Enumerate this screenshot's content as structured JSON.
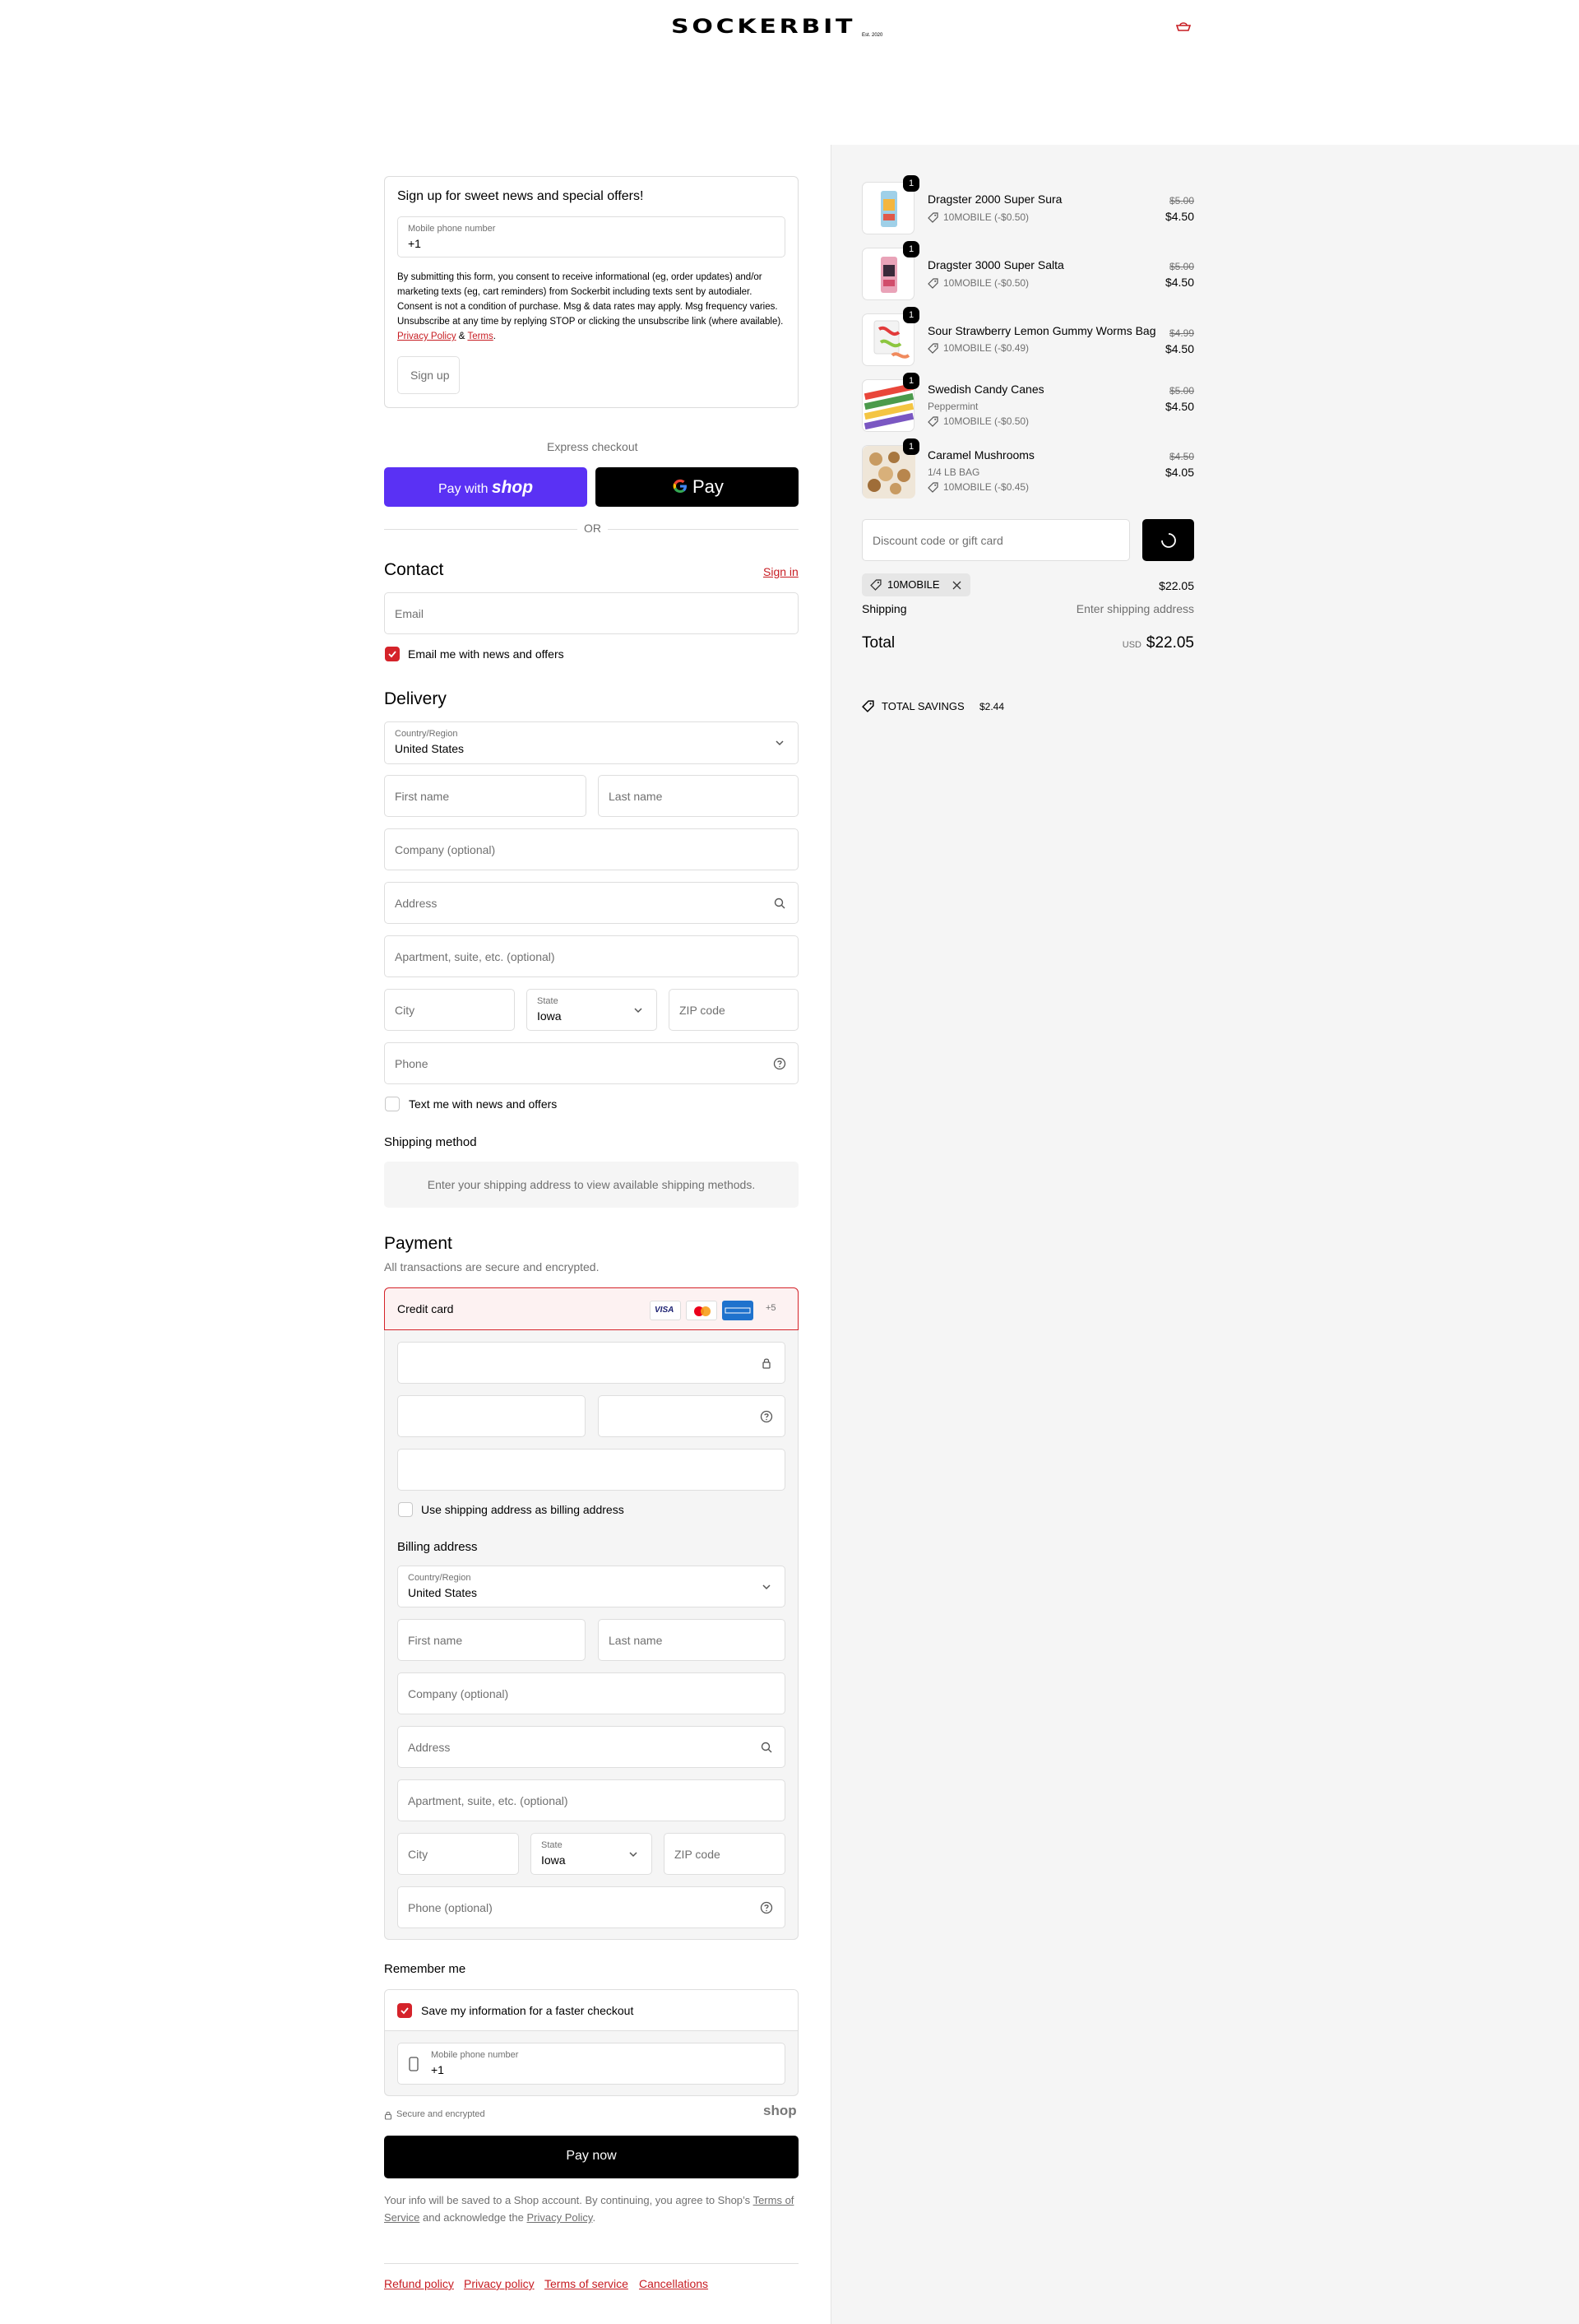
{
  "header": {
    "logo_text": "SOCKERBIT",
    "logo_sub": "Est. 2020"
  },
  "signup": {
    "title": "Sign up for sweet news and special offers!",
    "phone_label": "Mobile phone number",
    "phone_value": "+1",
    "consent": "By submitting this form, you consent to receive informational (eg, order updates) and/or marketing texts (eg, cart reminders) from Sockerbit including texts sent by autodialer. Consent is not a condition of purchase. Msg & data rates may apply. Msg frequency varies. Unsubscribe at any time by replying STOP or clicking the unsubscribe link (where available).",
    "privacy_link": "Privacy Policy",
    "amp": "&",
    "terms_link": "Terms",
    "button": "Sign up"
  },
  "express": {
    "title": "Express checkout",
    "shop_pay_prefix": "Pay with",
    "shop_pay_brand": "shop",
    "gpay_label": "Pay",
    "or": "OR"
  },
  "contact": {
    "title": "Contact",
    "sign_in": "Sign in",
    "email_placeholder": "Email",
    "news_label": "Email me with news and offers",
    "news_checked": true
  },
  "delivery": {
    "title": "Delivery",
    "country_label": "Country/Region",
    "country_value": "United States",
    "first_name": "First name",
    "last_name": "Last name",
    "company": "Company (optional)",
    "address": "Address",
    "apartment": "Apartment, suite, etc. (optional)",
    "city": "City",
    "state_label": "State",
    "state_value": "Iowa",
    "zip": "ZIP code",
    "phone": "Phone",
    "text_label": "Text me with news and offers",
    "text_checked": false
  },
  "shipping_method": {
    "title": "Shipping method",
    "notice": "Enter your shipping address to view available shipping methods."
  },
  "payment": {
    "title": "Payment",
    "subtitle": "All transactions are secure and encrypted.",
    "method_label": "Credit card",
    "cards": [
      "VISA",
      "mastercard",
      "AMEX"
    ],
    "more_cards": "+5",
    "billing_same_label": "Use shipping address as billing address",
    "billing_title": "Billing address",
    "billing": {
      "country_label": "Country/Region",
      "country_value": "United States",
      "first_name": "First name",
      "last_name": "Last name",
      "company": "Company (optional)",
      "address": "Address",
      "apartment": "Apartment, suite, etc. (optional)",
      "city": "City",
      "state_label": "State",
      "state_value": "Iowa",
      "zip": "ZIP code",
      "phone": "Phone (optional)"
    }
  },
  "remember": {
    "title": "Remember me",
    "save_label": "Save my information for a faster checkout",
    "save_checked": true,
    "phone_label": "Mobile phone number",
    "phone_value": "+1"
  },
  "secure": {
    "text": "Secure and encrypted",
    "brand": "shop"
  },
  "pay_now": "Pay now",
  "legal": {
    "line1": "Your info will be saved to a Shop account. By continuing, you agree to Shop’s",
    "tos": "Terms of Service",
    "mid": "and acknowledge the",
    "privacy": "Privacy Policy",
    "end": "."
  },
  "footer_links": [
    "Refund policy",
    "Privacy policy",
    "Terms of service",
    "Cancellations"
  ],
  "summary": {
    "items": [
      {
        "name": "Dragster 2000 Super Sura",
        "variant": "",
        "discount": "10MOBILE (-$0.50)",
        "old_price": "$5.00",
        "price": "$4.50",
        "qty": "1"
      },
      {
        "name": "Dragster 3000 Super Salta",
        "variant": "",
        "discount": "10MOBILE (-$0.50)",
        "old_price": "$5.00",
        "price": "$4.50",
        "qty": "1"
      },
      {
        "name": "Sour Strawberry Lemon Gummy Worms Bag",
        "variant": "",
        "discount": "10MOBILE (-$0.49)",
        "old_price": "$4.99",
        "price": "$4.50",
        "qty": "1"
      },
      {
        "name": "Swedish Candy Canes",
        "variant": "Peppermint",
        "discount": "10MOBILE (-$0.50)",
        "old_price": "$5.00",
        "price": "$4.50",
        "qty": "1"
      },
      {
        "name": "Caramel Mushrooms",
        "variant": "1/4 LB BAG",
        "discount": "10MOBILE (-$0.45)",
        "old_price": "$4.50",
        "price": "$4.05",
        "qty": "1"
      }
    ],
    "discount_placeholder": "Discount code or gift card",
    "applied_code": "10MOBILE",
    "subtotal_value": "$22.05",
    "shipping_label": "Shipping",
    "shipping_value": "Enter shipping address",
    "total_label": "Total",
    "currency": "USD",
    "total_value": "$22.05",
    "savings_label": "TOTAL SAVINGS",
    "savings_value": "$2.44"
  },
  "colors": {
    "accent": "#d5232a",
    "shop_purple": "#5a31f4",
    "summary_bg": "#f5f5f5"
  }
}
